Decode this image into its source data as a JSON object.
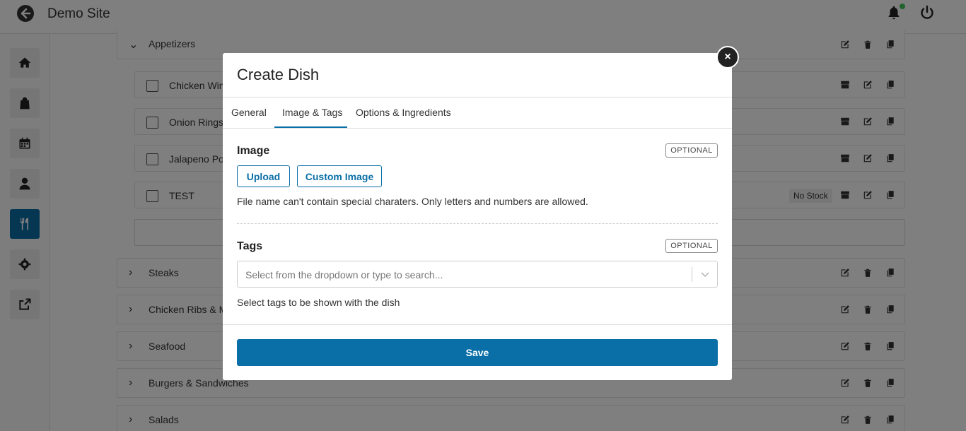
{
  "header": {
    "site_title": "Demo Site"
  },
  "rail": {
    "items": [
      "home-icon",
      "bag-icon",
      "calendar-icon",
      "user-icon",
      "utensils-icon",
      "gear-icon",
      "external-link-icon"
    ],
    "active_index": 4
  },
  "menu": {
    "categories": [
      {
        "label": "Appetizers",
        "expanded": true
      },
      {
        "label": "Steaks",
        "expanded": false
      },
      {
        "label": "Chicken Ribs & M",
        "expanded": false
      },
      {
        "label": "Seafood",
        "expanded": false
      },
      {
        "label": "Burgers & Sandwiches",
        "expanded": false
      },
      {
        "label": "Salads",
        "expanded": false
      }
    ],
    "items": [
      {
        "label": "Chicken Win",
        "badge": ""
      },
      {
        "label": "Onion Rings",
        "badge": ""
      },
      {
        "label": "Jalapeno Pop",
        "badge": ""
      },
      {
        "label": "TEST",
        "badge": "No Stock"
      }
    ]
  },
  "modal": {
    "title": "Create Dish",
    "close_icon": "×",
    "tabs": [
      {
        "label": "General",
        "active": false
      },
      {
        "label": "Image & Tags",
        "active": true
      },
      {
        "label": "Options & Ingredients",
        "active": false
      }
    ],
    "image_section": {
      "label": "Image",
      "optional": "OPTIONAL",
      "upload_label": "Upload",
      "custom_image_label": "Custom Image",
      "help": "File name can't contain special charaters. Only letters and numbers are allowed."
    },
    "tags_section": {
      "label": "Tags",
      "optional": "OPTIONAL",
      "placeholder": "Select from the dropdown or type to search...",
      "help": "Select tags to be shown with the dish"
    },
    "save_label": "Save"
  },
  "colors": {
    "accent": "#0a6fa7",
    "online": "#46c45a"
  }
}
